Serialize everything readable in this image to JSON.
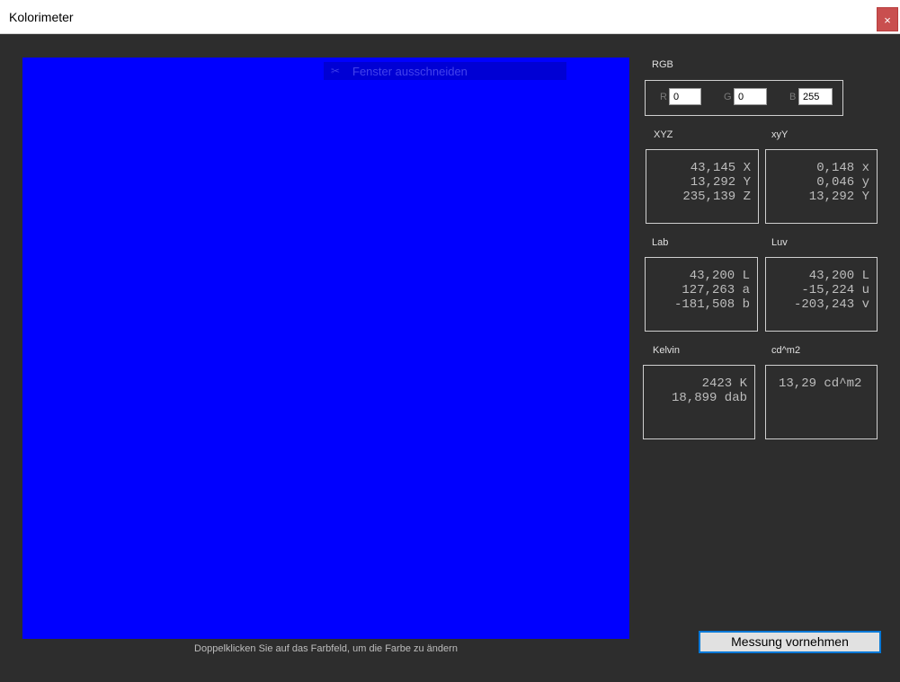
{
  "window": {
    "title": "Kolorimeter",
    "close_label": "×"
  },
  "swatch": {
    "color": "#0000ff",
    "ghost_text": "Fenster ausschneiden",
    "ghost_icon": "scissors-icon"
  },
  "hint": "Doppelklicken Sie auf das Farbfeld, um die Farbe zu ändern",
  "rgb": {
    "label": "RGB",
    "r_label": "R",
    "g_label": "G",
    "b_label": "B",
    "r": "0",
    "g": "0",
    "b": "255"
  },
  "xyz": {
    "label": "XYZ",
    "line1": "43,145 X",
    "line2": "13,292 Y",
    "line3": "235,139 Z"
  },
  "xyy": {
    "label": "xyY",
    "line1": "0,148 x",
    "line2": "0,046 y",
    "line3": "13,292 Y"
  },
  "lab": {
    "label": "Lab",
    "line1": "43,200 L",
    "line2": "127,263 a",
    "line3": "-181,508 b"
  },
  "luv": {
    "label": "Luv",
    "line1": "43,200 L",
    "line2": "-15,224 u",
    "line3": "-203,243 v"
  },
  "kelvin": {
    "label": "Kelvin",
    "line1": "2423 K",
    "line2": "18,899 dab"
  },
  "cdm2": {
    "label": "cd^m2",
    "line1": "13,29 cd^m2"
  },
  "measure_button": "Messung vornehmen"
}
